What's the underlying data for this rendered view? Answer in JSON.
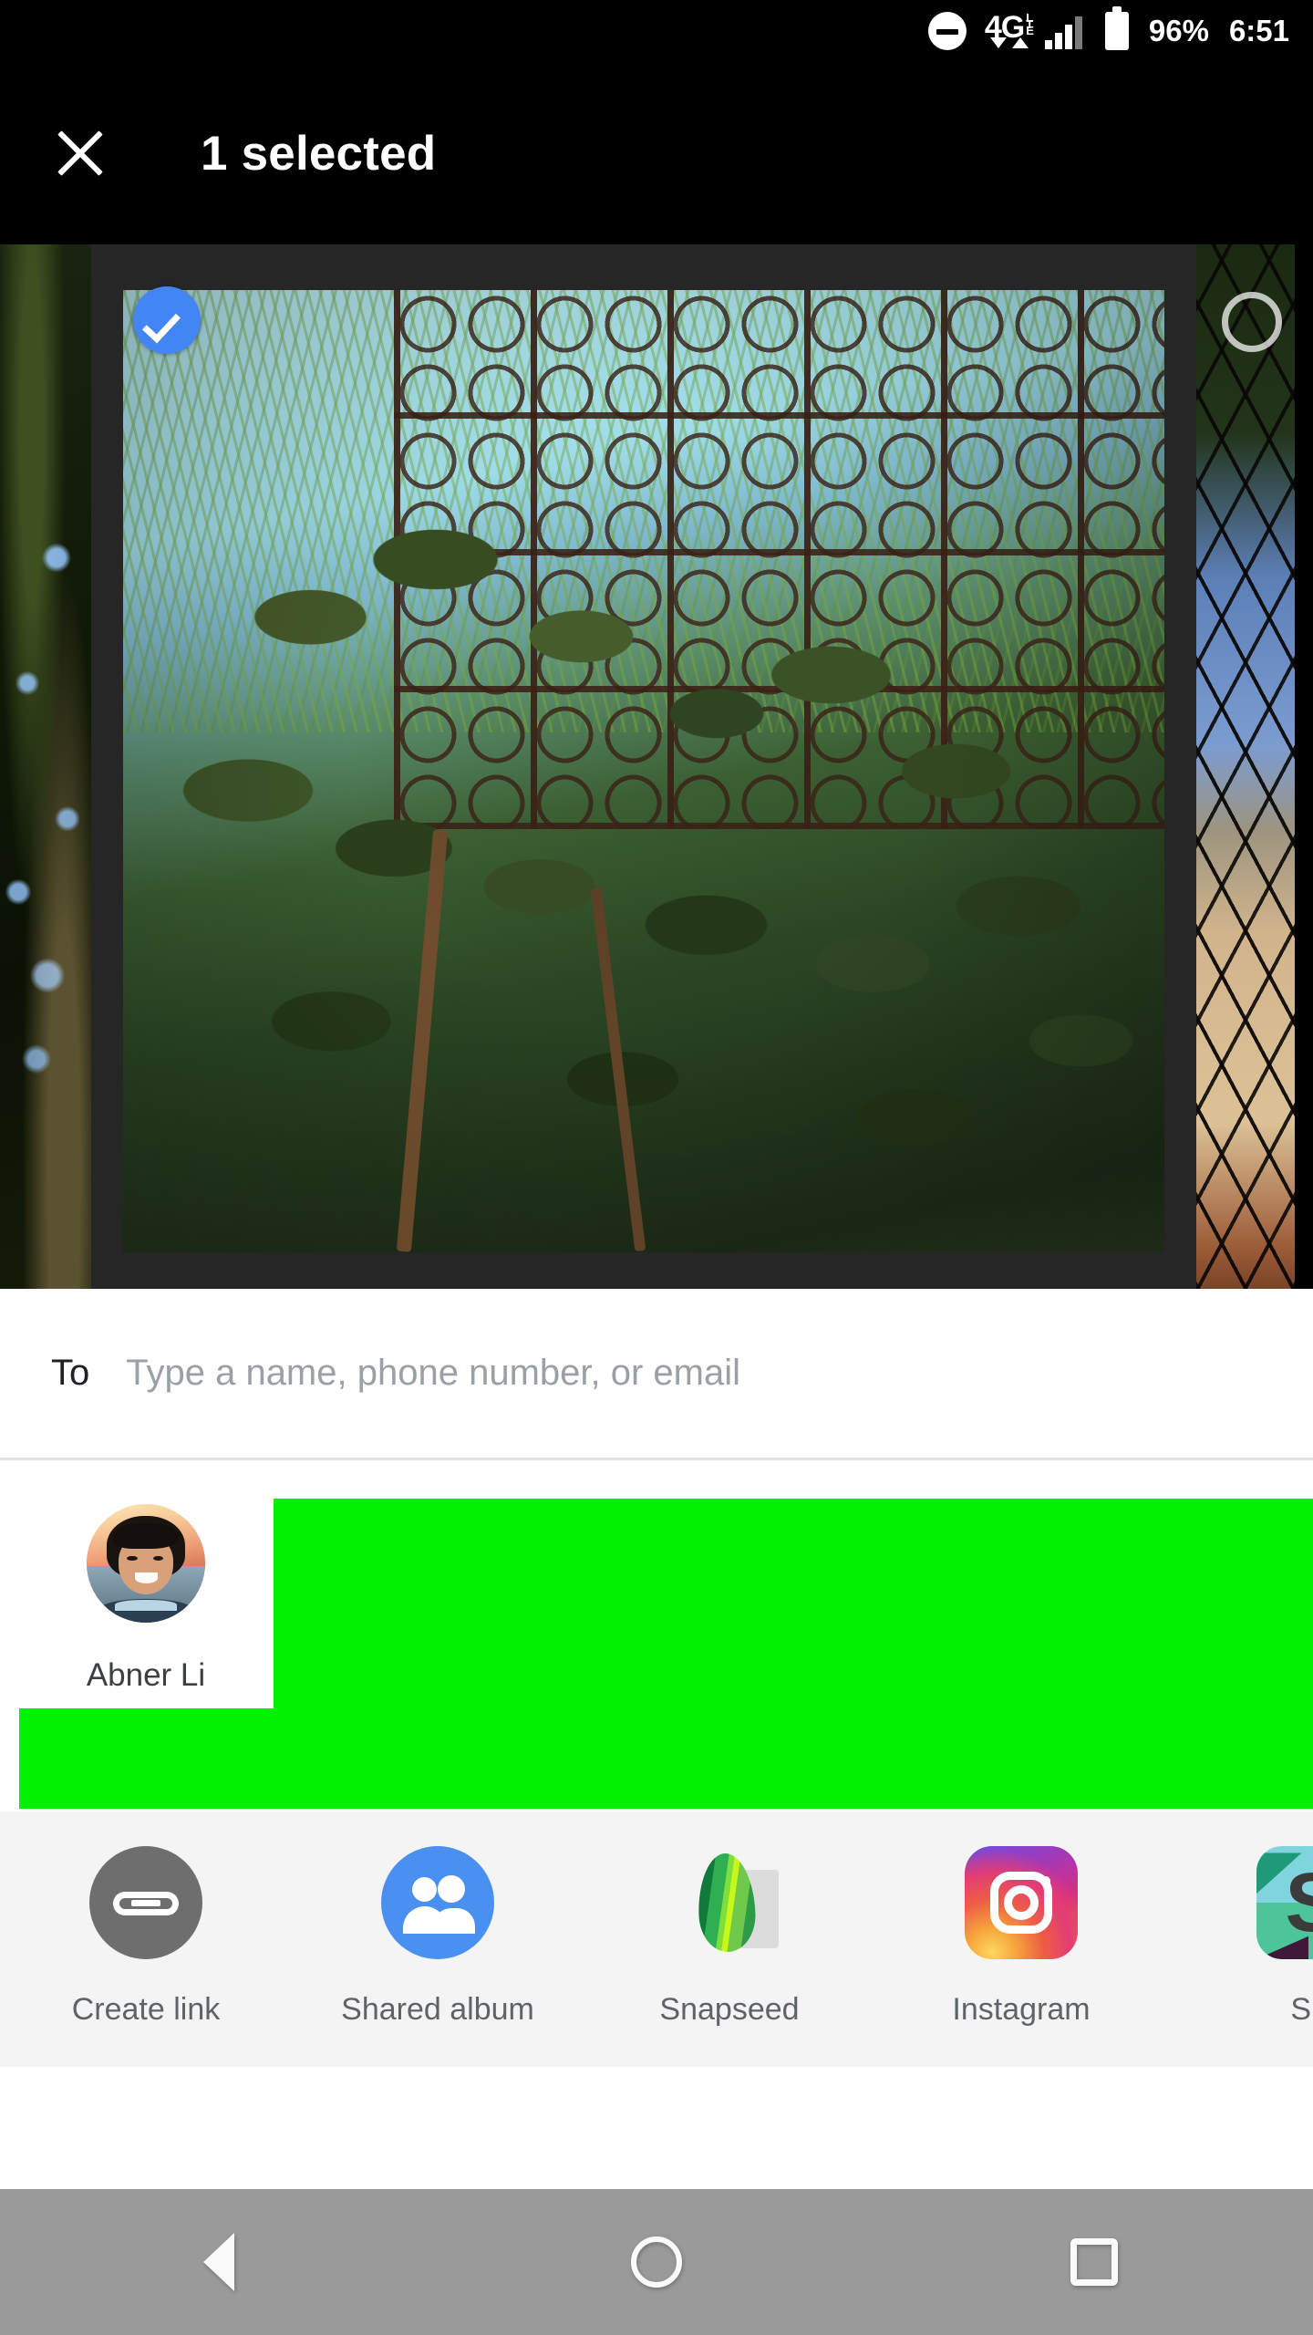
{
  "status_bar": {
    "dnd_icon": "do-not-disturb-icon",
    "network_type": "4G",
    "network_suffix": "LTE",
    "data_arrows": [
      "down-arrow-icon",
      "up-arrow-icon"
    ],
    "signal_icon": "signal-bars-icon",
    "battery_icon": "battery-full-icon",
    "battery_percent": "96%",
    "clock": "6:51"
  },
  "toolbar": {
    "close_icon": "close-icon",
    "title": "1 selected"
  },
  "photo_strip": {
    "selected_badge_icon": "check-circle-icon",
    "unselected_badge_icon": "circle-outline-icon",
    "thumbnails": [
      {
        "name": "previous-photo",
        "selected": false
      },
      {
        "name": "selected-photo",
        "selected": true
      },
      {
        "name": "next-photo",
        "selected": false
      }
    ]
  },
  "recipient": {
    "label": "To",
    "value": "",
    "placeholder": "Type a name, phone number, or email"
  },
  "contacts": [
    {
      "name": "Abner Li",
      "avatar": "contact-avatar"
    }
  ],
  "redaction": {
    "color": "#00f200"
  },
  "share_targets": [
    {
      "label": "Create link",
      "icon": "link-icon",
      "color": "#6e6e6e"
    },
    {
      "label": "Shared album",
      "icon": "people-icon",
      "color": "#4a90f0"
    },
    {
      "label": "Snapseed",
      "icon": "snapseed-icon",
      "color": "#2e9c46"
    },
    {
      "label": "Instagram",
      "icon": "instagram-icon",
      "color": "#e23d75"
    },
    {
      "label": "Sla",
      "icon": "slack-icon",
      "color": "#e8245f"
    }
  ],
  "nav_bar": {
    "back_label": "back-icon",
    "home_label": "home-icon",
    "recents_label": "recents-icon"
  },
  "colors": {
    "accent_blue": "#4285f4",
    "toolbar_bg": "#000000",
    "sheet_bg": "#ffffff",
    "app_row_bg": "#f4f4f4",
    "nav_bg": "#9a9a9a"
  }
}
